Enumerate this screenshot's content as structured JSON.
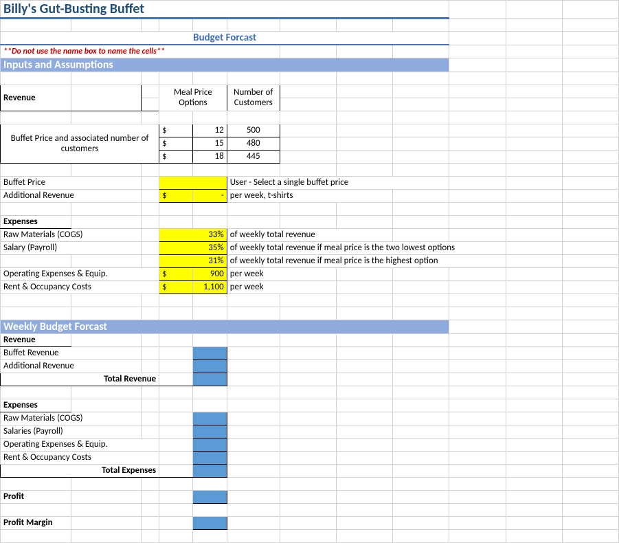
{
  "title": "Billy's Gut-Busting Buffet",
  "subtitle": "Budget Forcast",
  "warning": "**Do not use the name box to name the cells**",
  "inputs_header": "Inputs and Assumptions",
  "revenue_label": "Revenue",
  "meal_price_header": "Meal Price Options",
  "num_customers_header": "Number of Customers",
  "buffet_price_desc": "Buffet Price and associated number of customers",
  "price_table": [
    {
      "price": "12",
      "customers": "500"
    },
    {
      "price": "15",
      "customers": "480"
    },
    {
      "price": "18",
      "customers": "445"
    }
  ],
  "buffet_price_label": "Buffet Price",
  "buffet_price_note": "User - Select a single buffet price",
  "addl_revenue_label": "Additional Revenue",
  "addl_revenue_value": "-",
  "addl_revenue_note": "per week, t-shirts",
  "expenses_label": "Expenses",
  "raw_materials_label": "Raw Materials (COGS)",
  "raw_materials_pct": "33%",
  "raw_materials_note": "of weekly total revenue",
  "salary_label": "Salary (Payroll)",
  "salary_pct1": "35%",
  "salary_note1": "of weekly total revenue if meal price is the two lowest options",
  "salary_pct2": "31%",
  "salary_note2": "of weekly total revenue if meal price is the highest option",
  "opex_label": "Operating Expenses & Equip.",
  "opex_value": "900",
  "opex_note": "per week",
  "rent_label": "Rent & Occupancy Costs",
  "rent_value": "1,100",
  "rent_note": "per week",
  "weekly_header": "Weekly Budget Forcast",
  "wb_revenue": "Revenue",
  "wb_buffet_rev": "Buffet Revenue",
  "wb_addl_rev": "Additional Revenue",
  "wb_total_rev": "Total Revenue",
  "wb_expenses": "Expenses",
  "wb_raw": "Raw Materials (COGS)",
  "wb_salaries": "Salaries (Payroll)",
  "wb_opex": "Operating Expenses & Equip.",
  "wb_rent": "Rent & Occupancy Costs",
  "wb_total_exp": "Total Expenses",
  "wb_profit": "Profit",
  "wb_margin": "Profit Margin",
  "dollar": "$"
}
